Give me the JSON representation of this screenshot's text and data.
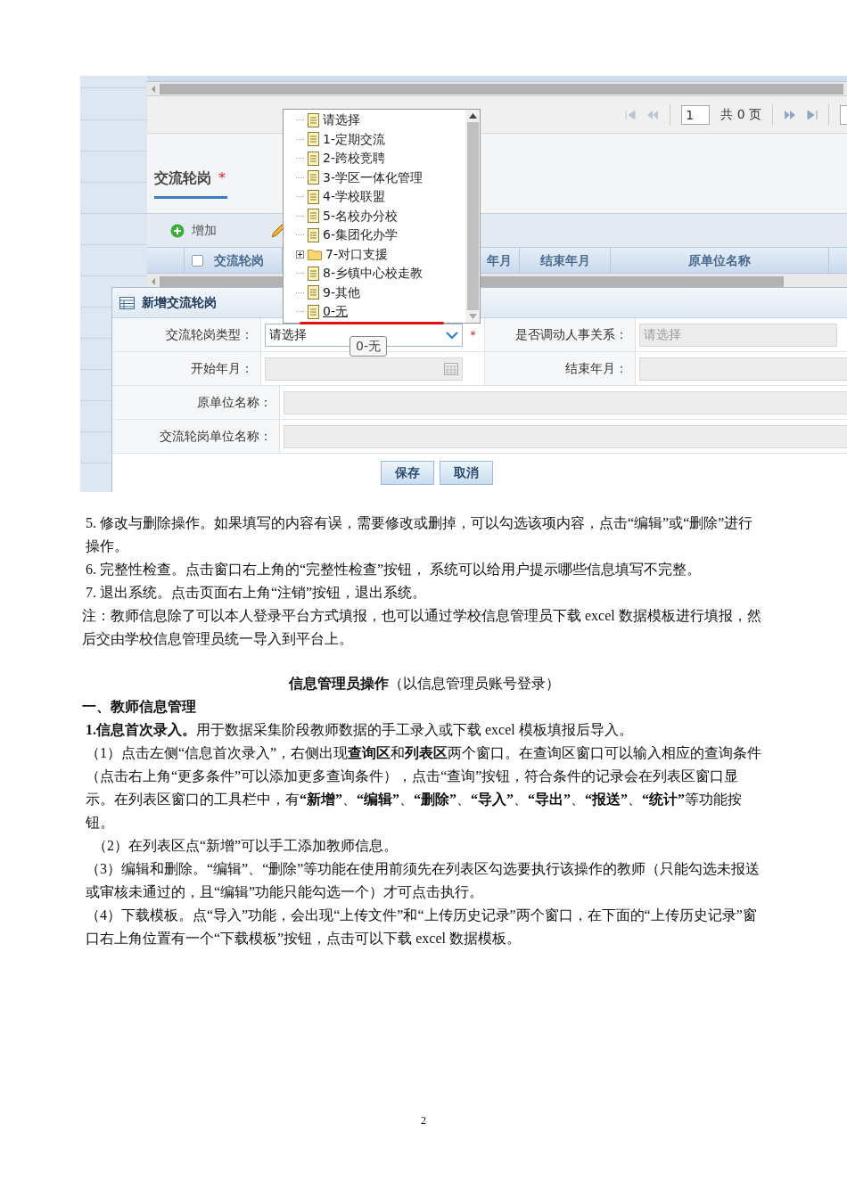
{
  "screenshot": {
    "pager": {
      "page_input": "1",
      "page_total": "共 0 页"
    },
    "section": {
      "title": "交流轮岗",
      "required_mark": "*"
    },
    "toolbar": {
      "add_label": "增加"
    },
    "grid": {
      "columns": [
        {
          "label": "交流轮岗",
          "kind": "check",
          "checked": false
        },
        {
          "label": "年月",
          "kind": "plain"
        },
        {
          "label": "结束年月",
          "kind": "plain"
        },
        {
          "label": "原单位名称",
          "kind": "wide"
        }
      ]
    },
    "dialog": {
      "title": "新增交流轮岗",
      "rows": [
        [
          {
            "label": "交流轮岗类型：",
            "kind": "select",
            "value": "请选择",
            "required": true,
            "disabled": false
          },
          {
            "label": "是否调动人事关系：",
            "kind": "select",
            "placeholder": "请选择",
            "disabled": true
          }
        ],
        [
          {
            "label": "开始年月：",
            "kind": "date",
            "disabled": true
          },
          {
            "label": "结束年月：",
            "kind": "text",
            "disabled": true
          }
        ],
        [
          {
            "label": "原单位名称：",
            "kind": "text",
            "disabled": true
          }
        ],
        [
          {
            "label": "交流轮岗单位名称：",
            "kind": "text",
            "disabled": true
          }
        ]
      ],
      "buttons": [
        "保存",
        "取消"
      ]
    },
    "dropdown": {
      "items": [
        {
          "label": "请选择",
          "kind": "leaf",
          "hovered": false
        },
        {
          "label": "1-定期交流",
          "kind": "leaf",
          "hovered": false
        },
        {
          "label": "2-跨校竞聘",
          "kind": "leaf",
          "hovered": false
        },
        {
          "label": "3-学区一体化管理",
          "kind": "leaf",
          "hovered": false
        },
        {
          "label": "4-学校联盟",
          "kind": "leaf",
          "hovered": false
        },
        {
          "label": "5-名校办分校",
          "kind": "leaf",
          "hovered": false
        },
        {
          "label": "6-集团化办学",
          "kind": "leaf",
          "hovered": false
        },
        {
          "label": "7-对口支援",
          "kind": "folder",
          "hovered": false
        },
        {
          "label": "8-乡镇中心校走教",
          "kind": "leaf",
          "hovered": false
        },
        {
          "label": "9-其他",
          "kind": "leaf",
          "hovered": false
        },
        {
          "label": "0-无",
          "kind": "leaf",
          "hovered": true
        }
      ]
    },
    "tooltip": "0-无"
  },
  "paragraphs": [
    {
      "kind": "item",
      "text": "5. 修改与删除操作。如果填写的内容有误，需要修改或删掉，可以勾选该项内容，点击“编辑”或“删除”进行操作。"
    },
    {
      "kind": "item",
      "text": "6. 完整性检查。点击窗口右上角的“完整性检查”按钮， 系统可以给用户提示哪些信息填写不完整。"
    },
    {
      "kind": "item",
      "text": "7. 退出系统。点击页面右上角“注销”按钮，退出系统。"
    },
    {
      "kind": "body",
      "text": "注：教师信息除了可以本人登录平台方式填报，也可以通过学校信息管理员下载 excel 数据模板进行填报，然后交由学校信息管理员统一导入到平台上。"
    },
    {
      "kind": "center",
      "text": "**信息管理员操作**（以信息管理员账号登录）"
    },
    {
      "kind": "heading",
      "text": "一、教师信息管理"
    },
    {
      "kind": "item",
      "text": "**1.信息首次录入。**用于数据采集阶段教师数据的手工录入或下载 excel 模板填报后导入。"
    },
    {
      "kind": "item",
      "text": "（1）点击左侧“信息首次录入”，右侧出现**查询区**和**列表区**两个窗口。在查询区窗口可以输入相应的查询条件（点击右上角“更多条件”可以添加更多查询条件），点击“查询”按钮，符合条件的记录会在列表区窗口显示。在列表区窗口的工具栏中，有**“新增”**、**“编辑”**、**“删除”**、**“导入”**、**“导出”**、**“报送”**、**“统计”**等功能按钮。"
    },
    {
      "kind": "sub",
      "text": "（2）在列表区点“新增”可以手工添加教师信息。"
    },
    {
      "kind": "item",
      "text": "（3）编辑和删除。“编辑”、“删除”等功能在使用前须先在列表区勾选要执行该操作的教师（只能勾选未报送或审核未通过的，且“编辑”功能只能勾选一个）才可点击执行。"
    },
    {
      "kind": "item",
      "text": "（4）下载模板。点“导入”功能，会出现“上传文件”和“上传历史记录”两个窗口，在下面的“上传历史记录”窗口右上角位置有一个“下载模板”按钮，点击可以下载 excel 数据模板。"
    }
  ],
  "page_number": "2"
}
